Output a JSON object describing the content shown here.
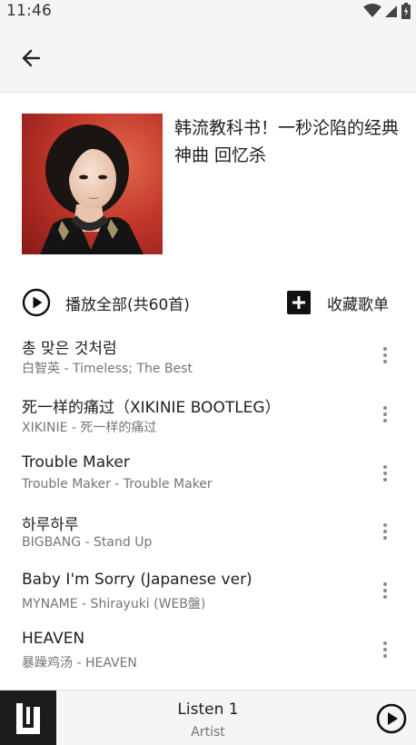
{
  "status_bar": {
    "time": "11:46",
    "icons": [
      "wifi-icon",
      "cellular-icon",
      "battery-icon"
    ]
  },
  "app_bar": {
    "back_icon": "arrow-left-icon"
  },
  "playlist": {
    "title": "韩流教科书！一秒沦陷的经典神曲 回忆杀",
    "play_all_label": "播放全部(共60首)",
    "collect_label": "收藏歌单"
  },
  "songs": [
    {
      "title": "총 맞은 것처럼",
      "subtitle": "白智英 - Timeless; The Best"
    },
    {
      "title": "死一样的痛过（XIKINIE BOOTLEG）",
      "subtitle": "XIKINIE - 死一样的痛过"
    },
    {
      "title": "Trouble Maker",
      "subtitle": "Trouble Maker - Trouble Maker"
    },
    {
      "title": "하루하루",
      "subtitle": "BIGBANG - Stand Up"
    },
    {
      "title": "Baby I'm Sorry (Japanese ver)",
      "subtitle": "MYNAME - Shirayuki (WEB盤)"
    },
    {
      "title": "HEAVEN",
      "subtitle": "暴躁鸡汤 - HEAVEN"
    }
  ],
  "player": {
    "title": "Listen 1",
    "artist": "Artist"
  },
  "colors": {
    "bar_bg": "#f5f5f5",
    "text_primary": "#212121",
    "text_secondary": "#757575",
    "logo_bg": "#1c1c1c"
  }
}
